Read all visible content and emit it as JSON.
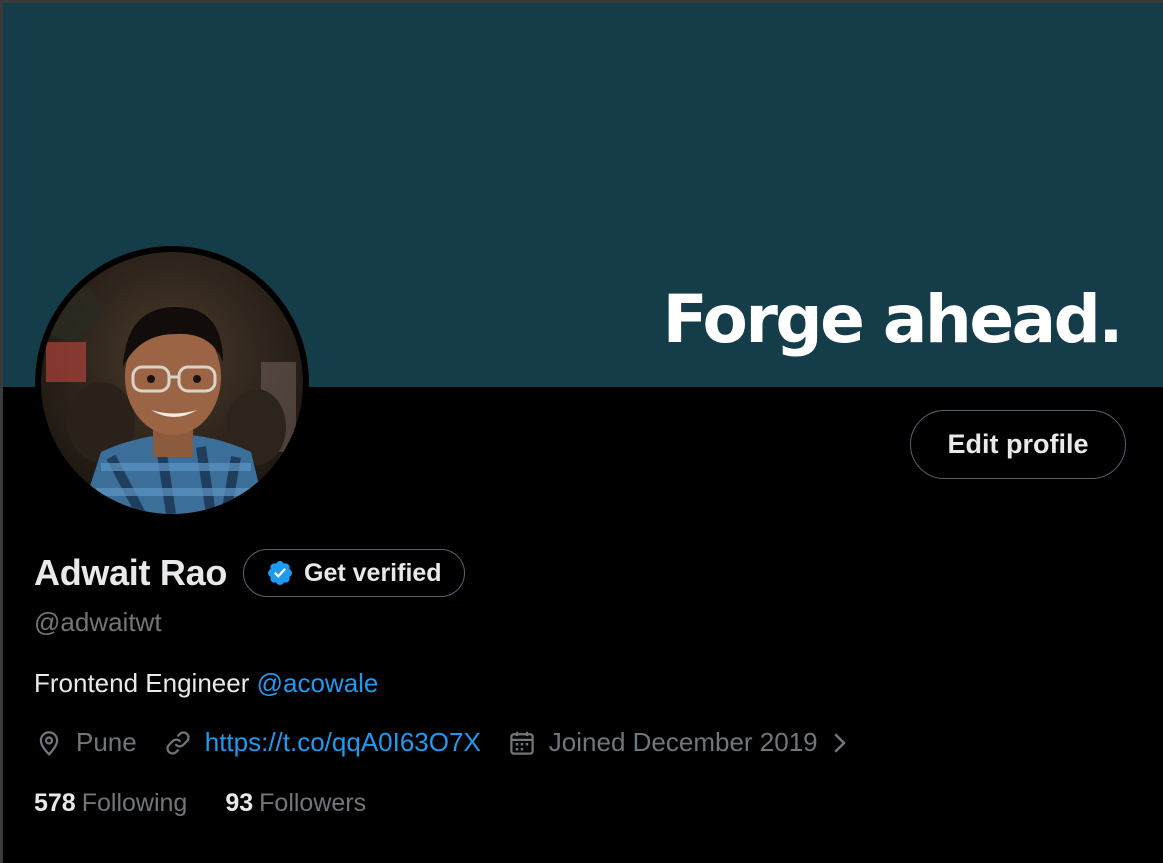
{
  "banner": {
    "text": "Forge ahead.",
    "color": "#143c49"
  },
  "profile": {
    "name": "Adwait Rao",
    "handle": "@adwaitwt",
    "bio_text": "Frontend Engineer",
    "bio_mention": "@acowale",
    "location": "Pune",
    "website": "https://t.co/qqA0I63O7X",
    "joined": "Joined December 2019",
    "following_count": "578",
    "following_label": "Following",
    "followers_count": "93",
    "followers_label": "Followers"
  },
  "buttons": {
    "edit_profile": "Edit profile",
    "get_verified": "Get verified"
  },
  "icons": {
    "location": "map-pin-icon",
    "website": "link-icon",
    "joined": "calendar-icon",
    "verified": "verified-badge-icon",
    "more": "chevron-right-icon"
  },
  "colors": {
    "accent": "#1d9bf0",
    "muted": "#71767b",
    "text": "#e7e9ea",
    "background": "#000000"
  }
}
